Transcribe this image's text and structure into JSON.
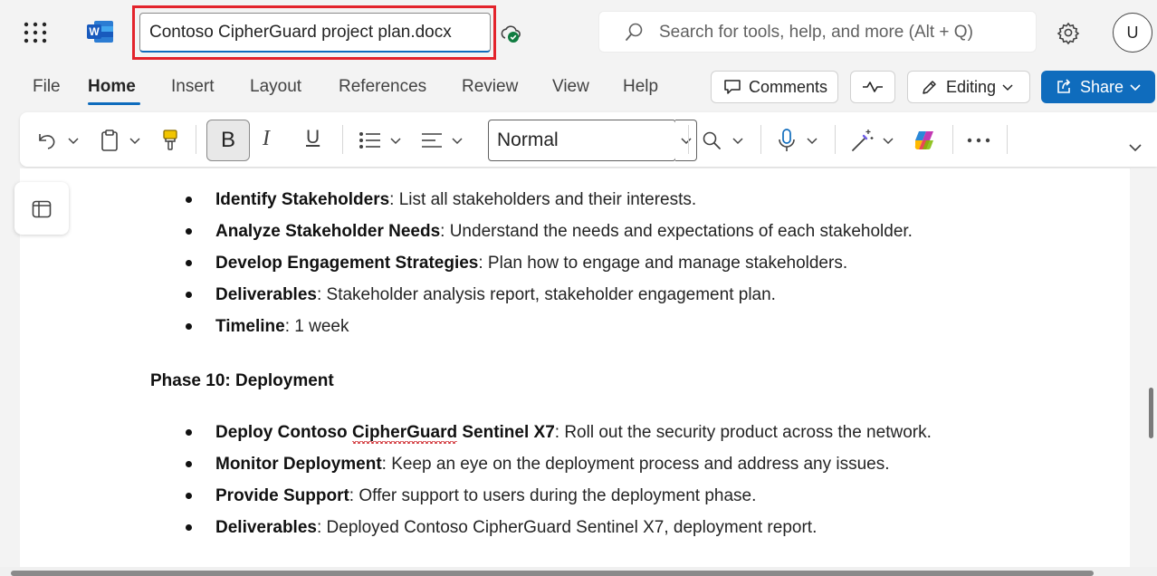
{
  "titlebar": {
    "app_icon": "word-logo-icon",
    "document_title": "Contoso CipherGuard project plan.docx",
    "cloud_status_icon": "cloud-saved-icon",
    "search_placeholder": "Search for tools, help, and more (Alt + Q)",
    "avatar_initial": "U",
    "highlight_color": "#e3232b"
  },
  "ribbon": {
    "tabs": [
      {
        "label": "File"
      },
      {
        "label": "Home",
        "active": true
      },
      {
        "label": "Insert"
      },
      {
        "label": "Layout"
      },
      {
        "label": "References"
      },
      {
        "label": "Review"
      },
      {
        "label": "View"
      },
      {
        "label": "Help"
      }
    ],
    "comments_label": "Comments",
    "editing_label": "Editing",
    "share_label": "Share",
    "accent_color": "#0f6cbd"
  },
  "toolbar": {
    "bold_label": "B",
    "italic_label": "I",
    "underline_label": "U",
    "style_value": "Normal"
  },
  "document": {
    "stakeholder_items": [
      {
        "term": "Identify Stakeholders",
        "desc": ": List all stakeholders and their interests."
      },
      {
        "term": "Analyze Stakeholder Needs",
        "desc": ": Understand the needs and expectations of each stakeholder."
      },
      {
        "term": "Develop Engagement Strategies",
        "desc": ": Plan how to engage and manage stakeholders."
      },
      {
        "term": "Deliverables",
        "desc": ": Stakeholder analysis report, stakeholder engagement plan."
      },
      {
        "term": "Timeline",
        "desc": ": 1 week"
      }
    ],
    "phase_heading": "Phase 10: Deployment",
    "deploy_first": {
      "term_part1": "Deploy Contoso ",
      "term_misspelled": "CipherGuard",
      "term_part2": " Sentinel X7",
      "desc": ": Roll out the security product across the network."
    },
    "deployment_items": [
      {
        "term": "Monitor Deployment",
        "desc": ": Keep an eye on the deployment process and address any issues."
      },
      {
        "term": "Provide Support",
        "desc": ": Offer support to users during the deployment phase."
      },
      {
        "term": "Deliverables",
        "desc": ": Deployed Contoso CipherGuard Sentinel X7, deployment report."
      }
    ]
  }
}
